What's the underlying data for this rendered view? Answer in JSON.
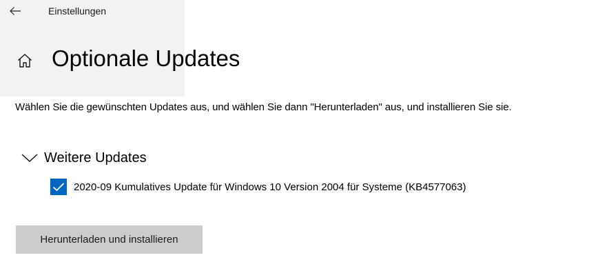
{
  "header": {
    "back_icon": "back-arrow-icon",
    "app_title": "Einstellungen"
  },
  "page": {
    "home_icon": "home-icon",
    "title": "Optionale Updates",
    "description": "Wählen Sie die gewünschten Updates aus, und wählen Sie dann \"Herunterladen\" aus, und installieren Sie sie."
  },
  "section": {
    "expand_icon": "chevron-down-icon",
    "title": "Weitere Updates",
    "expanded": true,
    "items": [
      {
        "label": "2020-09 Kumulatives Update für Windows 10 Version 2004 für Systeme (KB4577063)",
        "checked": true
      }
    ]
  },
  "actions": {
    "download_label": "Herunterladen und installieren"
  },
  "colors": {
    "accent": "#0067c0",
    "button_bg": "#cccccc",
    "panel_bg": "#f2f2f2"
  }
}
